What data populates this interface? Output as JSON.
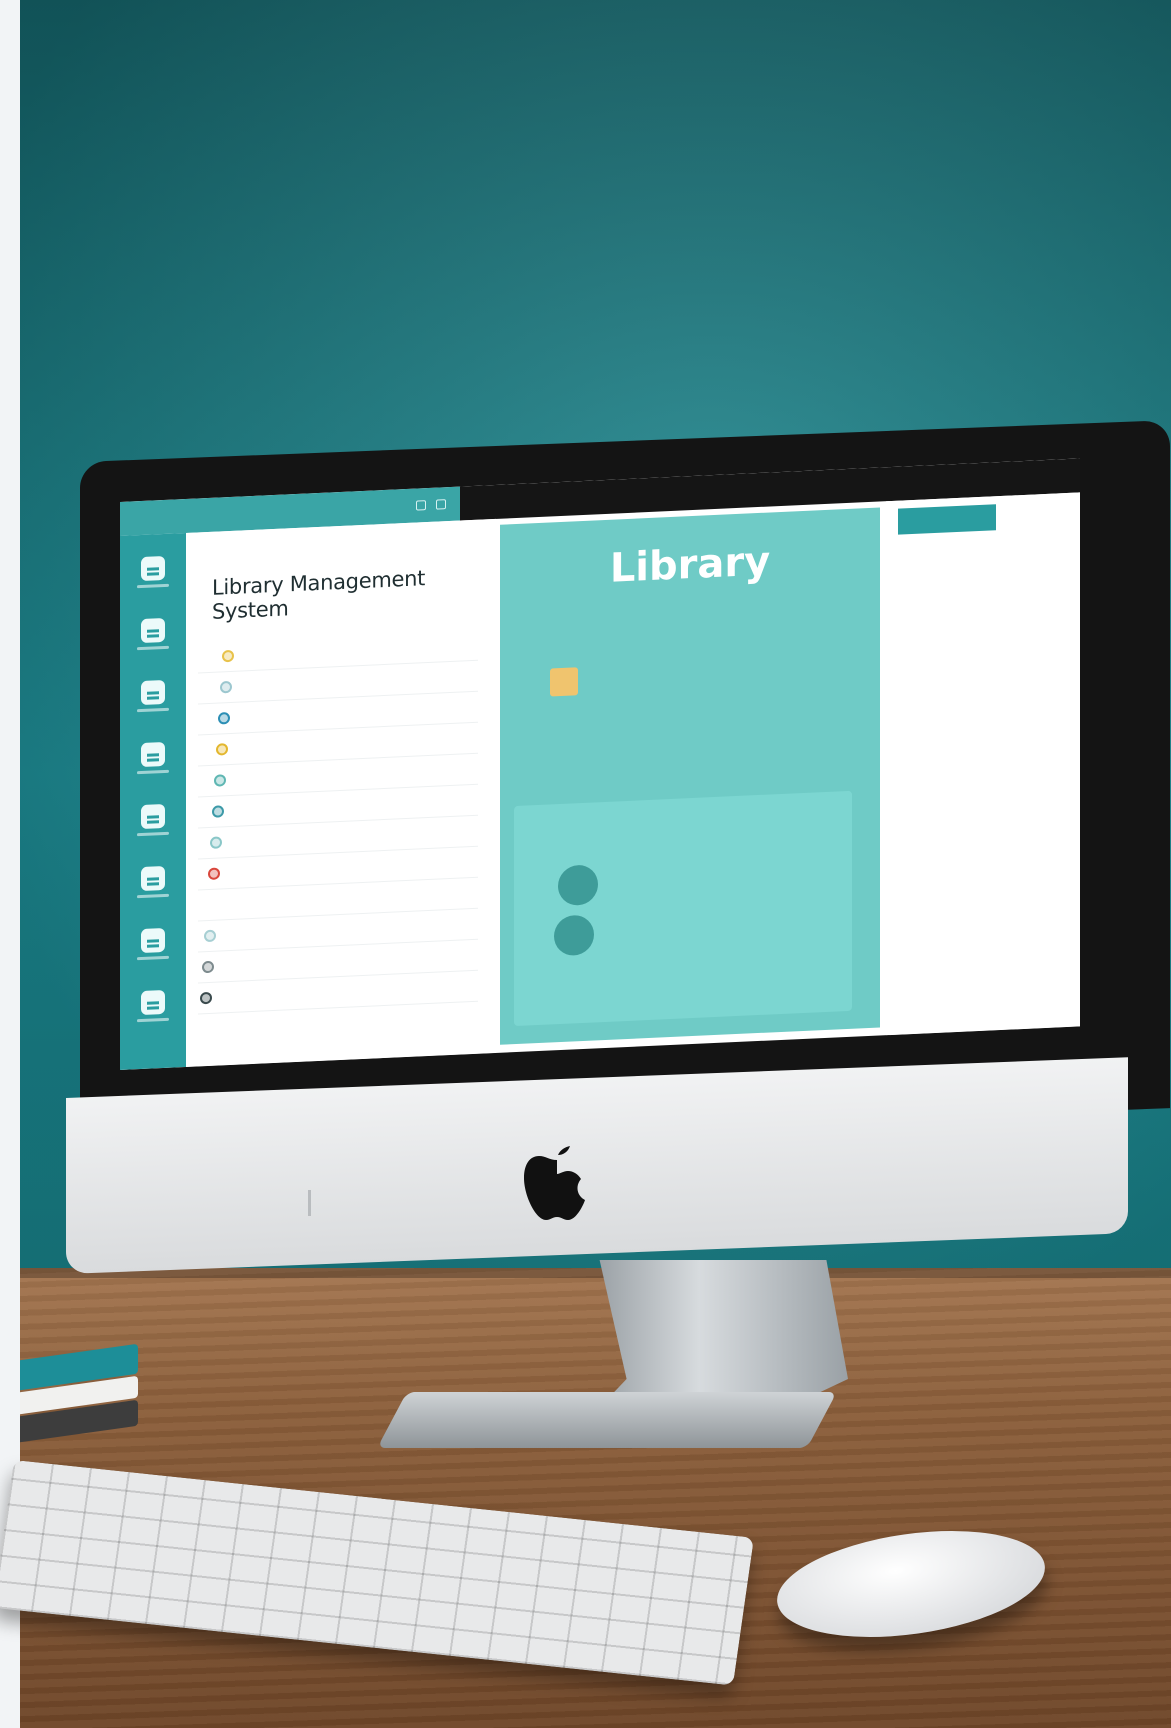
{
  "scene": {
    "wall_color": "#1a7f86",
    "desk_color": "#8c5f3b",
    "accent": "#2a9da0",
    "panel_color": "#6fcbc6"
  },
  "screen": {
    "topbar": {
      "items": [
        "",
        "",
        ""
      ],
      "icons": [
        "window-icon",
        "window-icon"
      ]
    },
    "sidebar": {
      "items": [
        {
          "icon": "book-icon"
        },
        {
          "icon": "document-icon"
        },
        {
          "icon": "library-icon"
        },
        {
          "icon": "archive-icon"
        },
        {
          "icon": "catalog-icon"
        },
        {
          "icon": "edit-icon"
        },
        {
          "icon": "shelf-icon"
        },
        {
          "icon": "user-icon"
        }
      ]
    },
    "main": {
      "breadcrumb": "",
      "title": "Library Management System",
      "list": [
        {
          "label": "",
          "dot": "#e8c24a"
        },
        {
          "label": "",
          "dot": "#9cc7cf"
        },
        {
          "label": "",
          "dot": "#2c8fb5"
        },
        {
          "label": "",
          "dot": "#e3b72e"
        },
        {
          "label": "",
          "dot": "#5fb7b3"
        },
        {
          "label": "",
          "dot": "#3d9aa8"
        },
        {
          "label": "",
          "dot": "#8ac7c8"
        },
        {
          "label": "",
          "dot": "#d9473c"
        },
        {
          "label": "",
          "dot": "#ffffff"
        },
        {
          "label": "",
          "dot": "#a7cfd3"
        },
        {
          "label": "",
          "dot": "#7d8b8e"
        },
        {
          "label": "",
          "dot": "#3a4a4d"
        }
      ]
    },
    "panel": {
      "title": "Library",
      "rows": [
        {
          "key": "",
          "value": ""
        },
        {
          "key": "",
          "value": ""
        },
        {
          "key": "",
          "value": ""
        },
        {
          "key": "",
          "value": ""
        }
      ],
      "card": {
        "head_key": "",
        "head_value": "",
        "items": [
          "",
          "",
          ""
        ],
        "footer": ""
      }
    },
    "right": {
      "action_label": ""
    }
  }
}
